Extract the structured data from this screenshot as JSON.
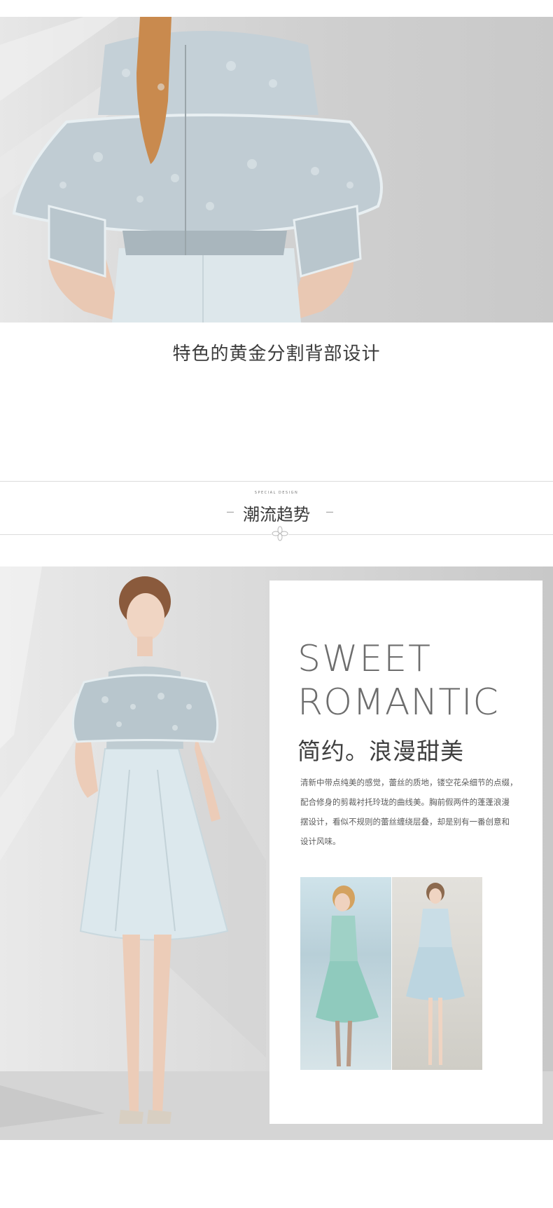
{
  "feature_caption": "特色的黄金分割背部设计",
  "section": {
    "eyebrow": "SPECIAL DESIGN",
    "title": "潮流趋势"
  },
  "card": {
    "headline_line1": "SWEET",
    "headline_line2": "ROMANTIC",
    "subtitle": "简约。浪漫甜美",
    "description": [
      "清新中带点纯美的感觉，蕾丝的质地，镂空花朵细节的点缀，",
      "配合修身的剪裁衬托玲珑的曲线美。胸前假两件的蓬蓬浪漫",
      "摆设计，看似不规则的蕾丝缠绕层叠，却是别有一番创意和",
      "设计风味。"
    ]
  },
  "colors": {
    "dress_blue": "#dfe8ec",
    "lace": "#c9d5db",
    "text_dark": "#3a3a3a"
  },
  "icons": [
    "flower-ornament-icon"
  ]
}
